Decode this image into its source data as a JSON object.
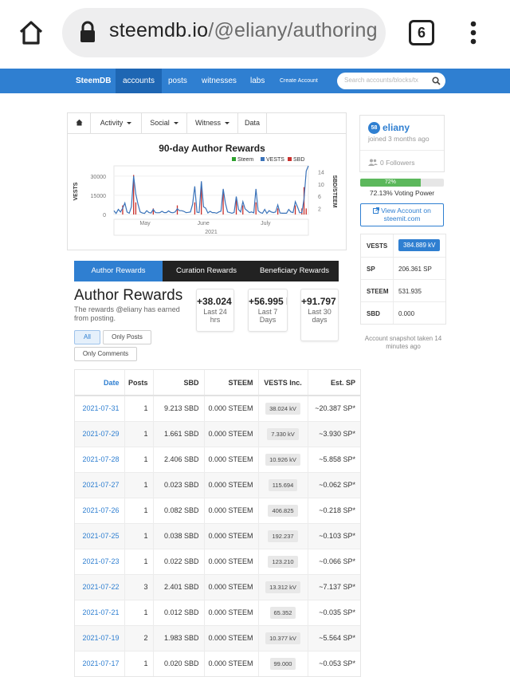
{
  "browser": {
    "url_host": "steemdb.io",
    "url_path": "/@eliany/authoring",
    "tab_count": "6"
  },
  "navbar": {
    "brand": "SteemDB",
    "links": [
      "accounts",
      "posts",
      "witnesses",
      "labs",
      "Create Account"
    ],
    "active": "accounts",
    "search_placeholder": "Search accounts/blocks/tx"
  },
  "panel_tabs": [
    "Activity",
    "Social",
    "Witness",
    "Data"
  ],
  "chart_data": {
    "type": "line",
    "title": "90-day Author Rewards",
    "legend": [
      "Steem",
      "VESTS",
      "SBD"
    ],
    "legend_colors": [
      "#2ca02c",
      "#3b73b9",
      "#c9302c"
    ],
    "ylabel_left": "VESTS",
    "ylabel_right": "SBD/STEEM",
    "yticks_left": [
      "30000",
      "15000",
      "0"
    ],
    "yticks_right": [
      "14",
      "10",
      "6",
      "2"
    ],
    "xticks": [
      "May",
      "June",
      "July"
    ],
    "xlabel_year": "2021",
    "ylim_left": [
      0,
      38000
    ],
    "ylim_right": [
      0,
      16
    ],
    "vests_series": [
      3000,
      800,
      4000,
      2000,
      5000,
      9000,
      2000,
      1000,
      6000,
      30000,
      16000,
      8000,
      2000,
      1200,
      900,
      3000,
      1500,
      1200,
      4000,
      1500,
      1400,
      1500,
      2500,
      1500,
      1500,
      2800,
      1600,
      1400,
      2000,
      4500,
      3000,
      3000,
      2500,
      1500,
      1700,
      2000,
      8000,
      22000,
      1800,
      1500,
      26000,
      6000,
      5000,
      1200,
      2500,
      1500,
      1500,
      1000,
      2000,
      2600,
      20000,
      9000,
      2000,
      1500,
      1000,
      1600,
      14000,
      4000,
      2000,
      10000,
      4500,
      3000,
      1500,
      2000,
      1300,
      20000,
      3000,
      1500,
      1000,
      4000,
      900,
      3000,
      2000,
      1500,
      2000,
      7500,
      1200,
      1000,
      1000,
      1000,
      4000,
      2000,
      1500,
      10000,
      6000,
      1400,
      1500,
      12000,
      34000,
      38000
    ],
    "sbd_bars": [
      {
        "i": 4,
        "v": 3
      },
      {
        "i": 9,
        "v": 13
      },
      {
        "i": 10,
        "v": 4
      },
      {
        "i": 18,
        "v": 2
      },
      {
        "i": 29,
        "v": 3
      },
      {
        "i": 37,
        "v": 4
      },
      {
        "i": 40,
        "v": 9
      },
      {
        "i": 50,
        "v": 7
      },
      {
        "i": 56,
        "v": 5
      },
      {
        "i": 59,
        "v": 3
      },
      {
        "i": 65,
        "v": 4
      },
      {
        "i": 75,
        "v": 2
      },
      {
        "i": 83,
        "v": 3
      },
      {
        "i": 86,
        "v": 2
      },
      {
        "i": 87,
        "v": 9
      },
      {
        "i": 88,
        "v": 2
      }
    ]
  },
  "reward_tabs": [
    "Author Rewards",
    "Curation Rewards",
    "Beneficiary Rewards"
  ],
  "heading": {
    "title": "Author Rewards",
    "desc": "The rewards @eliany has earned from posting."
  },
  "stats": [
    {
      "value": "+38.024 kV",
      "label": "Last 24 hrs"
    },
    {
      "value": "+56.995 kV",
      "label": "Last 7 Days"
    },
    {
      "value": "+91.797 kV",
      "label": "Last 30 days"
    }
  ],
  "filters": [
    "All",
    "Only Posts",
    "Only Comments"
  ],
  "table": {
    "headers": [
      "Date",
      "Posts",
      "SBD",
      "STEEM",
      "VESTS Inc.",
      "Est. SP"
    ],
    "rows": [
      [
        "2021-07-31",
        "1",
        "9.213 SBD",
        "0.000 STEEM",
        "38.024 kV",
        "~20.387 SP*"
      ],
      [
        "2021-07-29",
        "1",
        "1.661 SBD",
        "0.000 STEEM",
        "7.330 kV",
        "~3.930 SP*"
      ],
      [
        "2021-07-28",
        "1",
        "2.406 SBD",
        "0.000 STEEM",
        "10.926 kV",
        "~5.858 SP*"
      ],
      [
        "2021-07-27",
        "1",
        "0.023 SBD",
        "0.000 STEEM",
        "115.694",
        "~0.062 SP*"
      ],
      [
        "2021-07-26",
        "1",
        "0.082 SBD",
        "0.000 STEEM",
        "406.825",
        "~0.218 SP*"
      ],
      [
        "2021-07-25",
        "1",
        "0.038 SBD",
        "0.000 STEEM",
        "192.237",
        "~0.103 SP*"
      ],
      [
        "2021-07-23",
        "1",
        "0.022 SBD",
        "0.000 STEEM",
        "123.210",
        "~0.066 SP*"
      ],
      [
        "2021-07-22",
        "3",
        "2.401 SBD",
        "0.000 STEEM",
        "13.312 kV",
        "~7.137 SP*"
      ],
      [
        "2021-07-21",
        "1",
        "0.012 SBD",
        "0.000 STEEM",
        "65.352",
        "~0.035 SP*"
      ],
      [
        "2021-07-19",
        "2",
        "1.983 SBD",
        "0.000 STEEM",
        "10.377 kV",
        "~5.564 SP*"
      ],
      [
        "2021-07-17",
        "1",
        "0.020 SBD",
        "0.000 STEEM",
        "99.000",
        "~0.053 SP*"
      ]
    ]
  },
  "profile": {
    "reputation": "58",
    "name": "eliany",
    "joined": "joined 3 months ago",
    "followers": "0 Followers"
  },
  "voting_power": {
    "percent_label": "72%",
    "fraction": 0.7213,
    "label": "72.13% Voting Power"
  },
  "steemit_button": "View Account on steemit.com",
  "balances": [
    {
      "key": "VESTS",
      "value": "384.889 kV"
    },
    {
      "key": "SP",
      "value": "206.361 SP"
    },
    {
      "key": "STEEM",
      "value": "531.935"
    },
    {
      "key": "SBD",
      "value": "0.000"
    }
  ],
  "snapshot_note": "Account snapshot taken 14 minutes ago"
}
